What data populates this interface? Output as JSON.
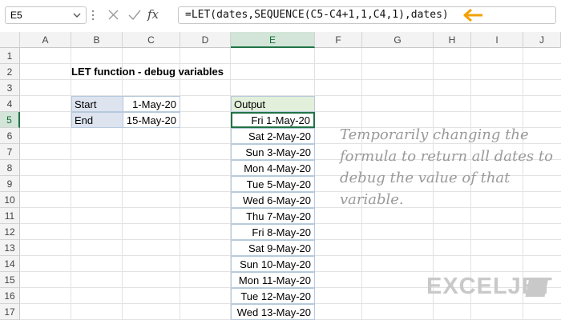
{
  "formula_bar": {
    "name_box": "E5",
    "formula": "=LET(dates,SEQUENCE(C5-C4+1,1,C4,1),dates)",
    "cancel_icon": "cancel-icon",
    "enter_icon": "check-icon",
    "function_icon": "fx-icon",
    "function_label": "fx"
  },
  "columns": [
    "A",
    "B",
    "C",
    "D",
    "E",
    "F",
    "G",
    "H",
    "I",
    "J"
  ],
  "rows": [
    "1",
    "2",
    "3",
    "4",
    "5",
    "6",
    "7",
    "8",
    "9",
    "10",
    "11",
    "12",
    "13",
    "14",
    "15",
    "16",
    "17"
  ],
  "sheet": {
    "title": "LET function - debug variables",
    "inputs": [
      {
        "label": "Start",
        "value": "1-May-20"
      },
      {
        "label": "End",
        "value": "15-May-20"
      }
    ],
    "output_header": "Output",
    "output": [
      "Fri 1-May-20",
      "Sat 2-May-20",
      "Sun 3-May-20",
      "Mon 4-May-20",
      "Tue 5-May-20",
      "Wed 6-May-20",
      "Thu 7-May-20",
      "Fri 8-May-20",
      "Sat 9-May-20",
      "Sun 10-May-20",
      "Mon 11-May-20",
      "Tue 12-May-20",
      "Wed 13-May-20"
    ]
  },
  "note": "Temporarily changing the formula to return all dates to debug the value of that variable.",
  "brand": "EXCELJET",
  "colors": {
    "accent": "#217346",
    "arrow": "#f2a100",
    "label_fill": "#dde4f0",
    "header_fill": "#e2efda"
  }
}
